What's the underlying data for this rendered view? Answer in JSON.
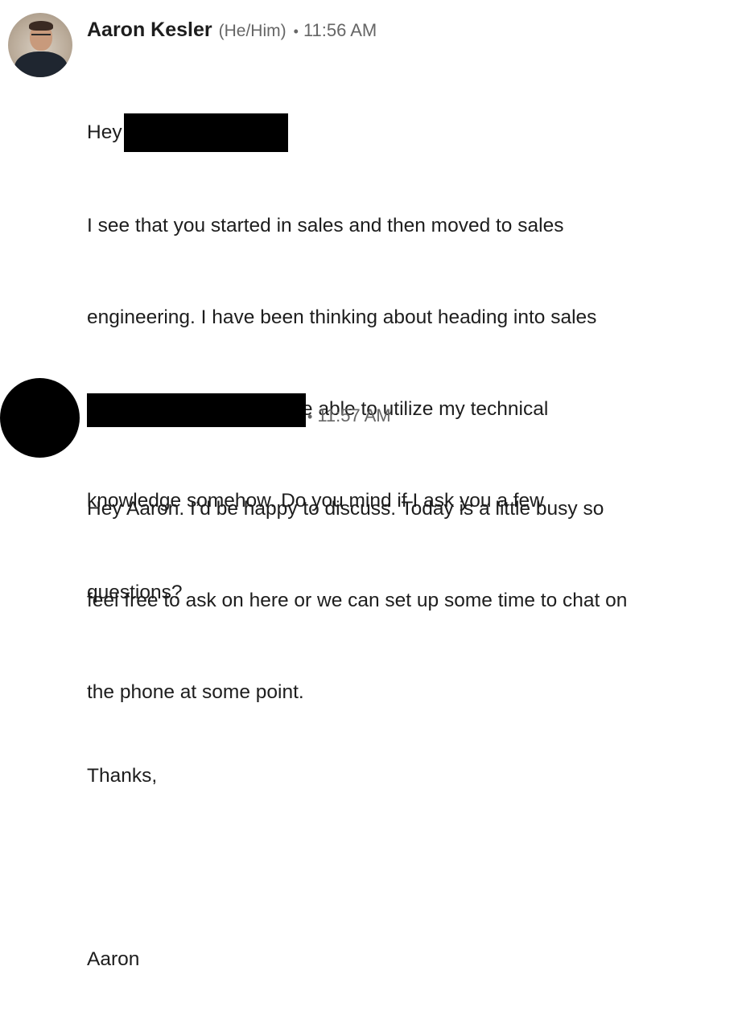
{
  "messages": [
    {
      "sender": "Aaron Kesler",
      "pronouns": "(He/Him)",
      "separator": "•",
      "time": "11:56 AM",
      "greeting": "Hey",
      "lines": [
        "I see that you started in sales and then moved to sales",
        "engineering. I have been thinking about heading into sales",
        "myself, but still want to be able to utilize my technical",
        "knowledge somehow. Do you mind if I ask you a few",
        "questions?",
        "",
        "Thanks,",
        "",
        "Aaron"
      ]
    },
    {
      "sender": "",
      "separator": "•",
      "time": "11:57 AM",
      "lines": [
        "Hey Aaron. I’d be happy to discuss. Today is a little busy so",
        "feel free to ask on here or we can set up some time to chat on",
        "the phone at some point."
      ]
    }
  ]
}
